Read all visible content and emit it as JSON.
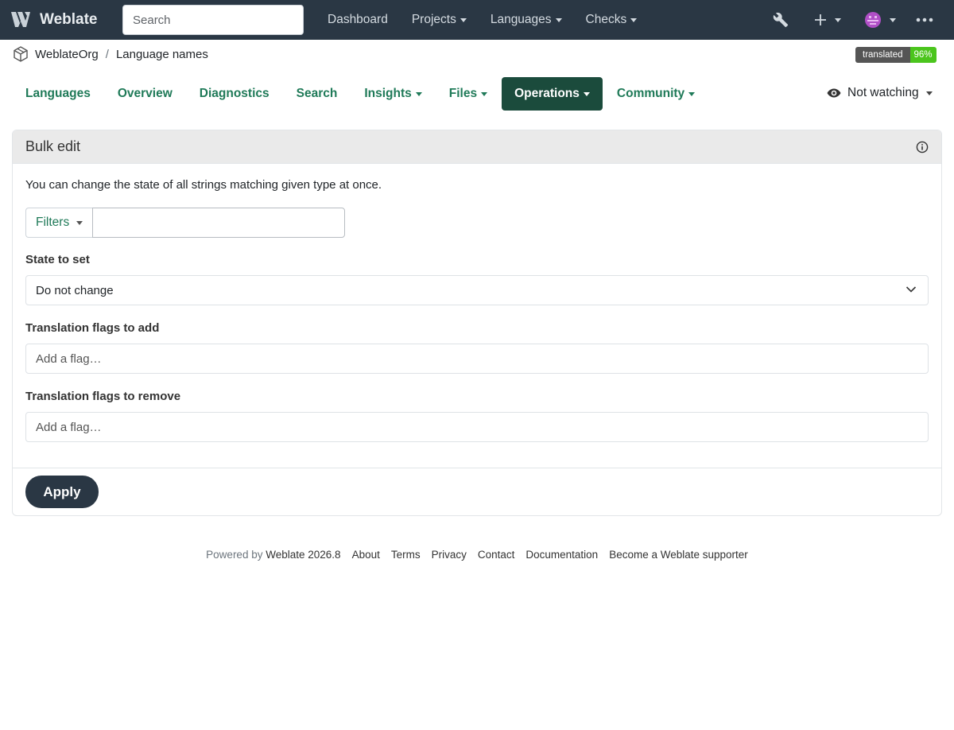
{
  "navbar": {
    "brand": "Weblate",
    "search_placeholder": "Search",
    "links": [
      {
        "label": "Dashboard",
        "dropdown": false
      },
      {
        "label": "Projects",
        "dropdown": true
      },
      {
        "label": "Languages",
        "dropdown": true
      },
      {
        "label": "Checks",
        "dropdown": true
      }
    ],
    "icons": [
      "wrench-icon",
      "plus-icon",
      "user-avatar",
      "more-icon"
    ]
  },
  "breadcrumb": {
    "organization": "WeblateOrg",
    "separator": "/",
    "project": "Language names"
  },
  "badge": {
    "label": "translated",
    "value": "96%",
    "value_color": "#4bc51d"
  },
  "tabs": [
    {
      "label": "Languages",
      "dropdown": false,
      "active": false
    },
    {
      "label": "Overview",
      "dropdown": false,
      "active": false
    },
    {
      "label": "Diagnostics",
      "dropdown": false,
      "active": false
    },
    {
      "label": "Search",
      "dropdown": false,
      "active": false
    },
    {
      "label": "Insights",
      "dropdown": true,
      "active": false
    },
    {
      "label": "Files",
      "dropdown": true,
      "active": false
    },
    {
      "label": "Operations",
      "dropdown": true,
      "active": true
    },
    {
      "label": "Community",
      "dropdown": true,
      "active": false
    }
  ],
  "watch": {
    "label": "Not watching"
  },
  "bulk_edit": {
    "title": "Bulk edit",
    "intro": "You can change the state of all strings matching given type at once.",
    "filters_label": "Filters",
    "filters_value": "",
    "state_label": "State to set",
    "state_value": "Do not change",
    "flags_add_label": "Translation flags to add",
    "flags_add_placeholder": "Add a flag…",
    "flags_remove_label": "Translation flags to remove",
    "flags_remove_placeholder": "Add a flag…",
    "apply_label": "Apply"
  },
  "footer": {
    "powered_by": "Powered by",
    "version": "Weblate 2026.8",
    "links": [
      "About",
      "Terms",
      "Privacy",
      "Contact",
      "Documentation",
      "Become a Weblate supporter"
    ]
  },
  "colors": {
    "navbar_bg": "#2a3744",
    "accent_green": "#1f7a58",
    "active_tab_bg": "#1b4b3c"
  }
}
